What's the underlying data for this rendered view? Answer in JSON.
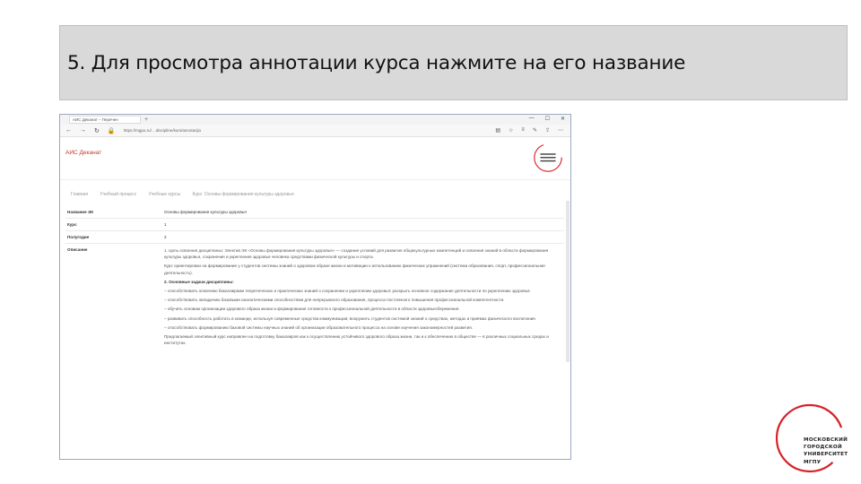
{
  "slide": {
    "title": "5. Для просмотра аннотации курса нажмите на его название"
  },
  "browser": {
    "tab_title": "АИС Деканат – Перечен",
    "url": "https://mgpu.ru/ ...discipline/kurs/annotacija",
    "minimize": "—",
    "maximize": "☐",
    "close": "✕"
  },
  "site": {
    "brand": "АИС Деканат",
    "breadcrumbs": [
      "Главная",
      "Учебный процесс",
      "Учебные курсы",
      "Курс: Основы формирования культуры здоровья"
    ]
  },
  "course": {
    "rows": [
      {
        "label": "Название ЭК",
        "value": "Основы формирования культуры здоровья"
      },
      {
        "label": "Курс",
        "value": "1"
      },
      {
        "label": "Полугодие",
        "value": "2"
      }
    ],
    "desc_label": "Описание",
    "desc_paragraphs": [
      "1. Цель освоения дисциплины: Электив ЭК «Основы формирования культуры здоровья» — создание условий для развития общекультурных компетенций и освоения знаний в области формирования культуры здоровья, сохранения и укрепления здоровья человека средствами физической культуры и спорта.",
      "Курс ориентирован на формирование у студентов системы знаний о здоровом образе жизни и мотивации к использованию физических упражнений (система образования, спорт, профессиональная деятельность).",
      "2. Основные задачи дисциплины:",
      "– способствовать освоению бакалаврами теоретических и практических знаний о сохранении и укреплении здоровья; раскрыть основное содержание деятельности по укреплению здоровья.",
      "– способствовать овладению базовыми аналитическими способностями для непрерывного образования, процесса постоянного повышения профессиональной компетентности.",
      "– обучить основам организации здорового образа жизни и формирования готовности к профессиональной деятельности в области здоровьесбережения.",
      "– развивать способность работать в команде, используя современные средства коммуникации; вооружить студентов системой знаний о средствах, методах и приёмах физического воспитания.",
      "– способствовать формированию базовой системы научных знаний об организации образовательного процесса на основе изучения закономерностей развития.",
      "Предлагаемый элективный курс направлен на подготовку бакалавров как к осуществлению устойчивого здорового образа жизни, так и к обеспечению в обществе — в различных социальных средах и институтах."
    ]
  },
  "university": {
    "lines": [
      "МОСКОВСКИЙ",
      "ГОРОДСКОЙ",
      "УНИВЕРСИТЕТ",
      "МГПУ"
    ],
    "accent": "#d6222a"
  }
}
